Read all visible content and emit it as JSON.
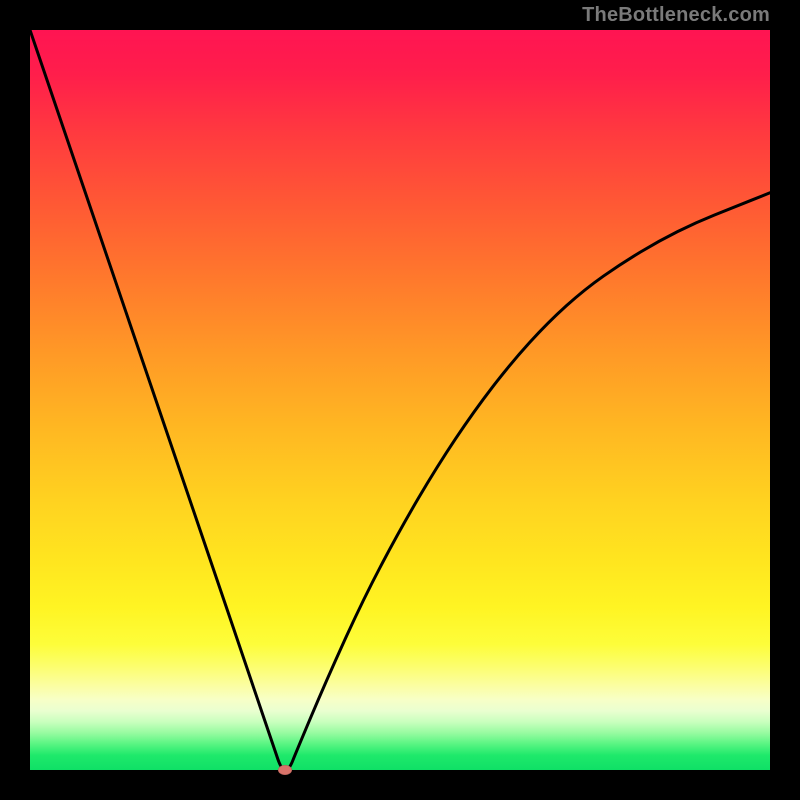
{
  "watermark": "TheBottleneck.com",
  "colors": {
    "frame_background": "#000000",
    "curve_stroke": "#000000",
    "marker_fill": "#d9736a",
    "gradient_top": "#ff1452",
    "gradient_bottom": "#0fe066"
  },
  "chart_data": {
    "type": "line",
    "title": "",
    "xlabel": "",
    "ylabel": "",
    "xlim": [
      0,
      100
    ],
    "ylim": [
      0,
      100
    ],
    "grid": false,
    "series": [
      {
        "name": "bottleneck-curve",
        "x": [
          0,
          5,
          10,
          15,
          20,
          25,
          30,
          33,
          34,
          35,
          36,
          40,
          45,
          50,
          55,
          60,
          65,
          70,
          75,
          80,
          85,
          90,
          95,
          100
        ],
        "values": [
          100,
          85.3,
          70.6,
          55.9,
          41.2,
          26.5,
          11.8,
          2.9,
          0,
          0,
          2.5,
          12.0,
          23.0,
          32.5,
          41.0,
          48.5,
          55.0,
          60.5,
          65.0,
          68.5,
          71.5,
          74.0,
          76.0,
          78.0
        ]
      }
    ],
    "marker": {
      "x": 34.5,
      "y": 0
    },
    "annotations": []
  }
}
